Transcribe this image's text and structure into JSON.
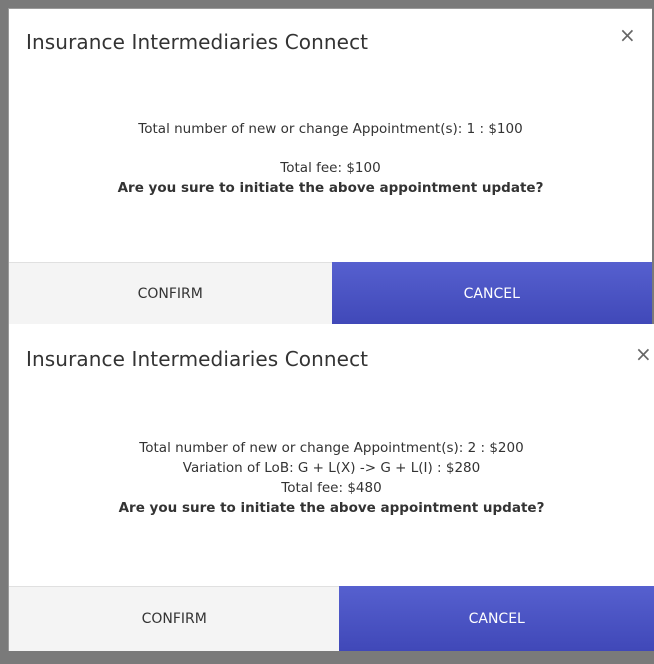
{
  "dialog1": {
    "title": "Insurance Intermediaries Connect",
    "close_symbol": "×",
    "lines": [
      "Total number of new or change Appointment(s): 1 : $100",
      "Total fee: $100"
    ],
    "question": "Are you sure to initiate the above appointment update?",
    "confirm_label": "CONFIRM",
    "cancel_label": "CANCEL"
  },
  "dialog2": {
    "title": "Insurance Intermediaries Connect",
    "close_symbol": "×",
    "lines": [
      "Total number of new or change Appointment(s): 2 : $200",
      "Variation of LoB: G + L(X) -> G + L(I) : $280",
      "Total fee: $480"
    ],
    "question": "Are you sure to initiate the above appointment update?",
    "confirm_label": "CONFIRM",
    "cancel_label": "CANCEL"
  },
  "colors": {
    "primary": "#4a53c4",
    "overlay": "#7a7a7a"
  },
  "icons": {
    "close": "close-icon"
  }
}
